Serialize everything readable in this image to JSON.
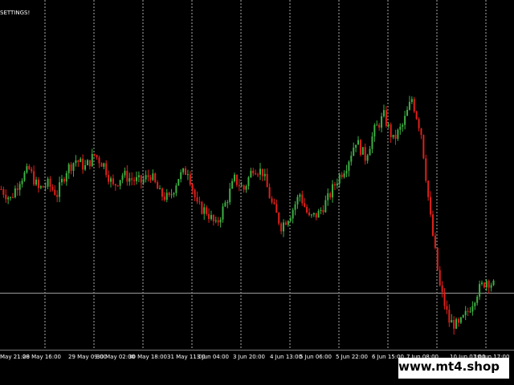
{
  "header": {
    "settings_label": "SETTINGS!"
  },
  "watermark": {
    "text": "www.mt4.shop"
  },
  "chart_data": {
    "type": "candlestick",
    "x_ticks": [
      "May 21:00",
      "28 May 16:00",
      "29 May 09:00",
      "30 May 02:00",
      "30 May 18:00",
      "31 May 11:00",
      "3 Jun 04:00",
      "3 Jun 20:00",
      "4 Jun 13:00",
      "5 Jun 06:00",
      "5 Jun 22:00",
      "6 Jun 15:00",
      "7 Jun 08:00",
      "10 Jun 01:00",
      "10 Jun 17:00"
    ],
    "grid": "vertical-dashed",
    "horizontal_line": "current-level",
    "colors": {
      "background": "#000000",
      "bull": "#3cb043",
      "bear": "#e0201a",
      "grid": "#c8c8c8",
      "axis_text": "#ffffff",
      "level_line": "#9a9a9a"
    },
    "price_path": [
      0.62,
      0.58,
      0.66,
      0.7,
      0.62,
      0.64,
      0.6,
      0.7,
      0.74,
      0.71,
      0.76,
      0.72,
      0.63,
      0.68,
      0.66,
      0.65,
      0.68,
      0.6,
      0.58,
      0.67,
      0.7,
      0.55,
      0.53,
      0.47,
      0.56,
      0.66,
      0.62,
      0.71,
      0.69,
      0.56,
      0.47,
      0.52,
      0.6,
      0.5,
      0.52,
      0.58,
      0.66,
      0.72,
      0.82,
      0.75,
      0.86,
      0.92,
      0.82,
      0.88,
      0.99,
      0.85,
      0.5,
      0.22,
      0.08,
      0.06,
      0.12,
      0.2,
      0.25,
      0.22
    ]
  }
}
